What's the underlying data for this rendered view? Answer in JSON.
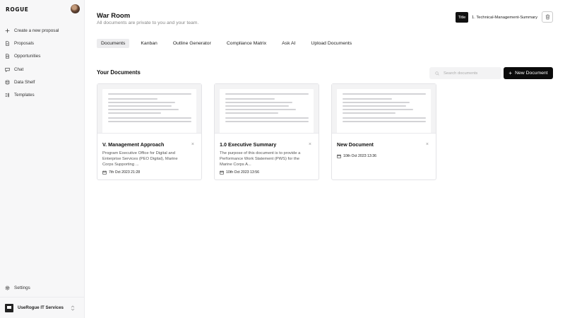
{
  "brand": {
    "name": "ROGUE"
  },
  "sidebar": {
    "items": [
      {
        "label": "Create a new proposal",
        "icon": "plus-icon"
      },
      {
        "label": "Proposals",
        "icon": "file-icon"
      },
      {
        "label": "Opportunities",
        "icon": "document-search-icon"
      },
      {
        "label": "Chat",
        "icon": "chat-icon"
      },
      {
        "label": "Data Shelf",
        "icon": "database-icon"
      },
      {
        "label": "Templates",
        "icon": "template-icon"
      }
    ],
    "settings_label": "Settings",
    "org_name": "UseRogue IT Services"
  },
  "header": {
    "title": "War Room",
    "subtitle": "All documents are private to you and your team.",
    "title_chip": "Title",
    "title_value": "1. Technical-Management-Summary"
  },
  "tabs": [
    {
      "label": "Documents",
      "active": true
    },
    {
      "label": "Kanban",
      "active": false
    },
    {
      "label": "Outline Generator",
      "active": false
    },
    {
      "label": "Compliance Matrix",
      "active": false
    },
    {
      "label": "Ask AI",
      "active": false
    },
    {
      "label": "Upload Documents",
      "active": false
    }
  ],
  "documents_section": {
    "title": "Your Documents",
    "search_placeholder": "Search documents",
    "new_button_label": "New Document",
    "cards": [
      {
        "title": "V. Management Approach",
        "description": "Program Executive Office for Digital and Enterprise Services (PEO Digital), Marine Corps Supporting ...",
        "date": "7th Oct 2023 21:28"
      },
      {
        "title": "1.0 Executive Summary",
        "description": "The purpose of this document is to provide a Performance Work Statement (PWS) for the Marine Corps A...",
        "date": "10th Oct 2023 13:56"
      },
      {
        "title": "New Document",
        "description": "",
        "date": "10th Oct 2023 13:36"
      }
    ]
  },
  "colors": {
    "primary_button": "#0b0b0b",
    "active_tab_bg": "#ececee",
    "sidebar_bg": "#f7f7f8"
  }
}
